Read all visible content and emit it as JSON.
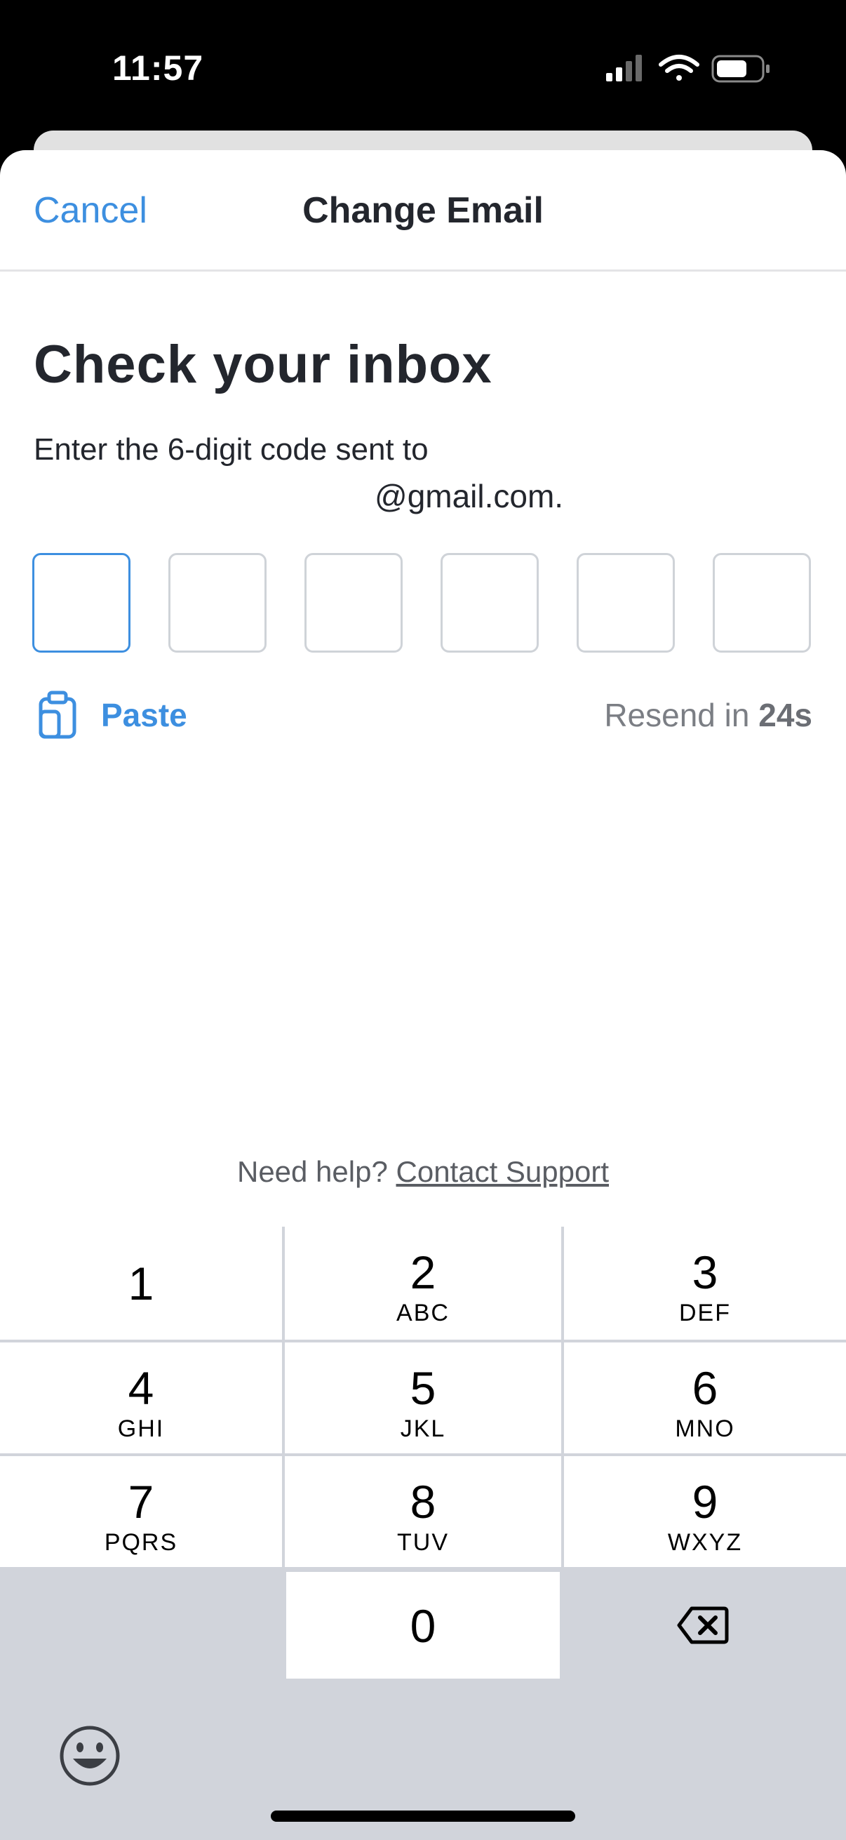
{
  "status_bar": {
    "time": "11:57"
  },
  "nav": {
    "cancel_label": "Cancel",
    "title": "Change Email"
  },
  "main": {
    "heading": "Check your inbox",
    "subtitle": "Enter the 6-digit code sent to",
    "email": "@gmail.com.",
    "code_digits": [
      "",
      "",
      "",
      "",
      "",
      ""
    ],
    "paste_label": "Paste",
    "resend_prefix": "Resend in",
    "resend_countdown": "24s"
  },
  "help": {
    "prompt": "Need help?",
    "link": "Contact Support"
  },
  "keypad": {
    "keys": [
      {
        "digit": "1",
        "letters": ""
      },
      {
        "digit": "2",
        "letters": "ABC"
      },
      {
        "digit": "3",
        "letters": "DEF"
      },
      {
        "digit": "4",
        "letters": "GHI"
      },
      {
        "digit": "5",
        "letters": "JKL"
      },
      {
        "digit": "6",
        "letters": "MNO"
      },
      {
        "digit": "7",
        "letters": "PQRS"
      },
      {
        "digit": "8",
        "letters": "TUV"
      },
      {
        "digit": "9",
        "letters": "WXYZ"
      },
      {
        "digit": "0",
        "letters": ""
      }
    ]
  },
  "colors": {
    "accent": "#3d8fe0",
    "text": "#23262d",
    "keypad_bg": "#d1d4db"
  }
}
